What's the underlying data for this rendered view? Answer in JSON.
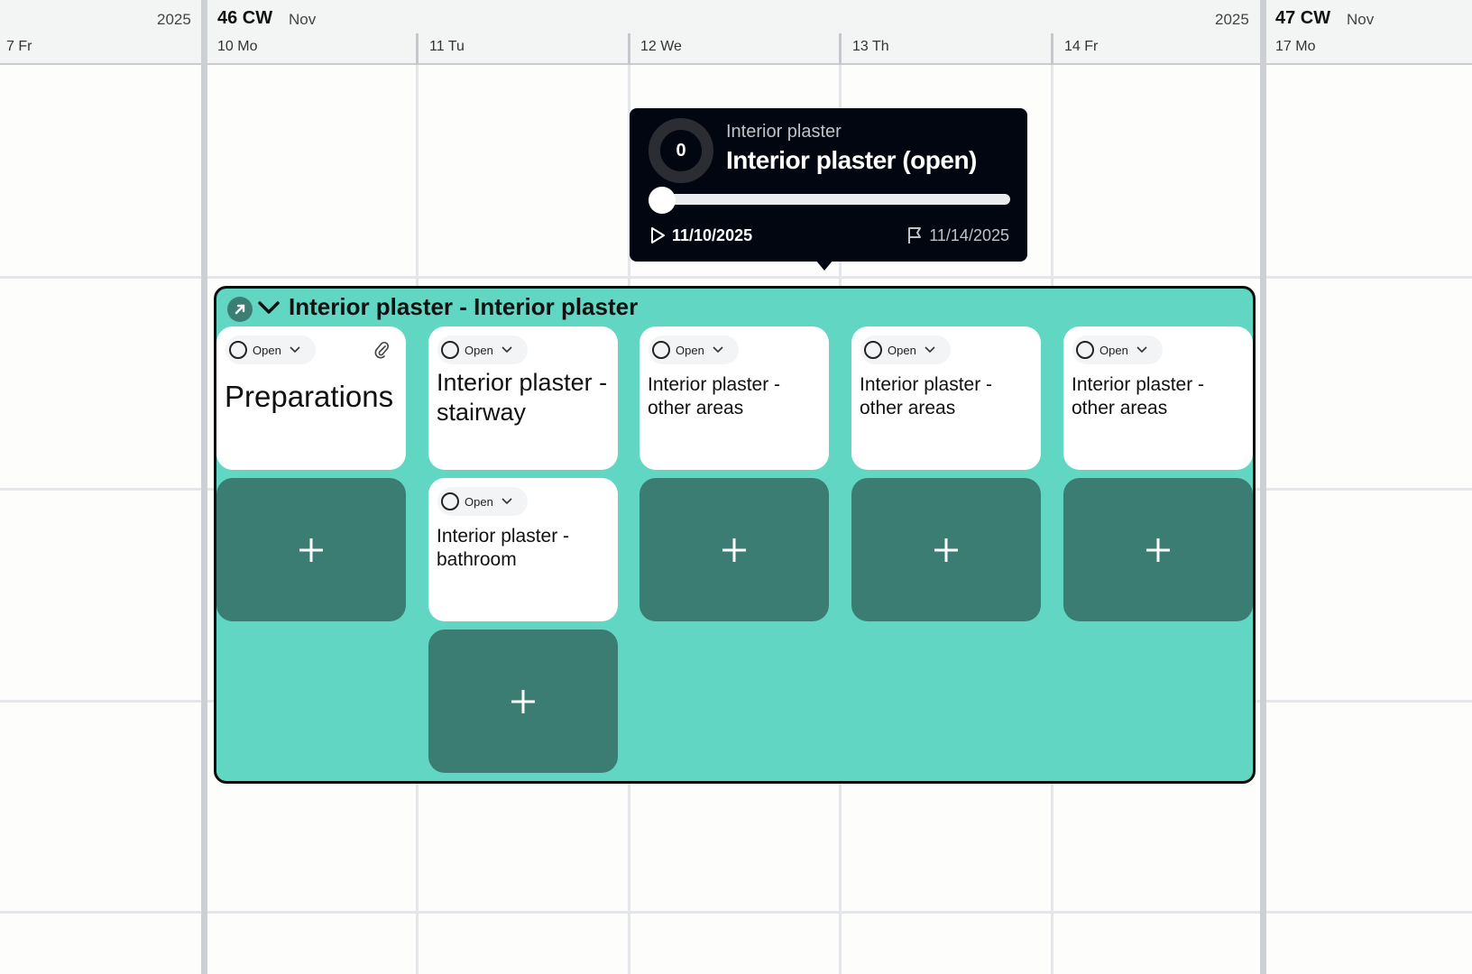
{
  "header": {
    "left_partial_year": "2025",
    "left_partial_day": "7 Fr",
    "week1": {
      "cw": "46 CW",
      "month": "Nov",
      "year": "2025",
      "days": [
        "10 Mo",
        "11 Tu",
        "12 We",
        "13 Th",
        "14 Fr"
      ]
    },
    "week2": {
      "cw": "47 CW",
      "month": "Nov",
      "day": "17 Mo"
    }
  },
  "group": {
    "title": "Interior plaster - Interior plaster",
    "icon": "arrow-up-right-icon",
    "bg_color": "#61d6c3"
  },
  "cards": [
    {
      "status": "Open",
      "title": "Preparations",
      "has_attachment": true
    },
    {
      "status": "Open",
      "title": "Interior plaster - stairway"
    },
    {
      "status": "Open",
      "title": "Interior plaster - other areas"
    },
    {
      "status": "Open",
      "title": "Interior plaster - other areas"
    },
    {
      "status": "Open",
      "title": "Interior plaster - other areas"
    },
    {
      "status": "Open",
      "title": "Interior plaster - bathroom"
    }
  ],
  "tooltip": {
    "progress_value": "0",
    "progress_fraction": 0,
    "subtitle": "Interior plaster",
    "title": "Interior plaster (open)",
    "start_date": "11/10/2025",
    "end_date": "11/14/2025"
  }
}
